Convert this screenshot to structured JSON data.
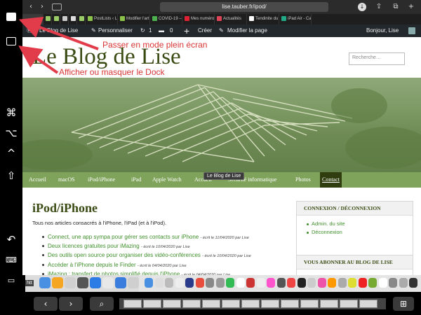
{
  "sidebar": {
    "icons": [
      "fullscreen-icon",
      "toggle-dock-icon",
      "command-icon",
      "option-icon",
      "control-icon",
      "shift-icon",
      "undo-icon",
      "keyboard-icon",
      "disconnect-icon"
    ]
  },
  "browser": {
    "url": "lise.tauber.fr/ipod/",
    "tabs": [
      "PostLists ‹ L…",
      "Modifier l'art…",
      "COVID-19 –…",
      "Mes numéro…",
      "Actualités",
      "Tendinite du…",
      "iPad Air - Ca…"
    ]
  },
  "adminbar": {
    "site": "Le Blog de Lise",
    "customize": "Personnaliser",
    "updates": "1",
    "comments": "0",
    "new": "Créer",
    "edit": "Modifier la page",
    "greeting": "Bonjour, Lise"
  },
  "page": {
    "blog_title": "Le Blog de Lise",
    "search_placeholder": "Recherche…",
    "nav": [
      "Accueil",
      "macOS",
      "iPod/iPhone",
      "iPad",
      "Apple Watch",
      "Accueil",
      "Sécurité informatique",
      "Photos",
      "Contact"
    ],
    "tooltip": "Le Blog de Lise",
    "heading": "iPod/iPhone",
    "intro": "Tous nos articles consacrés à l'iPhone, l'iPad (et à l'iPod).",
    "posts": [
      {
        "title": "Connect, une app sympa pour gérer ses contacts sur iPhone",
        "meta": "- écrit le 11/04/2020 par Lise"
      },
      {
        "title": "Deux licences gratuites pour iMazing",
        "meta": "- écrit le 10/04/2020 par Lise"
      },
      {
        "title": "Des outils open source pour organiser des vidéo-conférences",
        "meta": "- écrit le 10/04/2020 par Lise"
      },
      {
        "title": "Accéder à l'iPhone depuis le Finder",
        "meta": "- écrit le 04/04/2020 par Lise"
      },
      {
        "title": "iMazing : transfert de photos simplifié depuis l'iPhone",
        "meta": "- écrit le 04/04/2020 par Lise"
      }
    ],
    "widget1": {
      "title": "CONNEXION / DÉCONNEXION",
      "links": [
        "Admin. du site",
        "Déconnexion"
      ]
    },
    "widget2": {
      "title": "VOUS ABONNER AU BLOG DE LISE"
    }
  },
  "annotations": {
    "fullscreen": "Passer en mode plein écran",
    "dock": "Afficher ou masquer le Dock",
    "color": "#d93535"
  },
  "dock": {
    "url_hint": "htt"
  }
}
